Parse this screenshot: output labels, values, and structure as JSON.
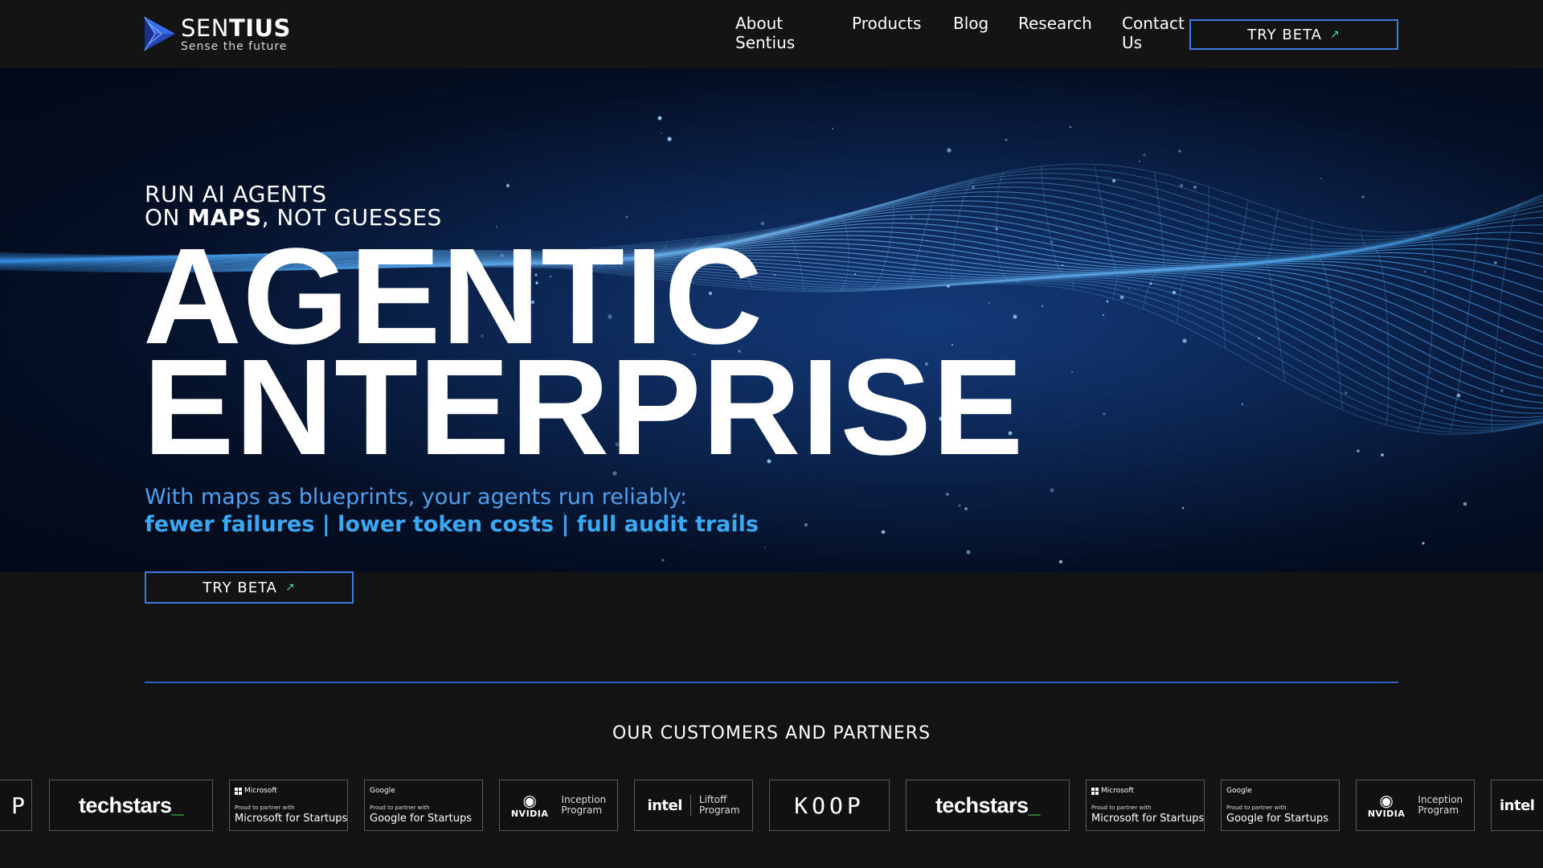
{
  "brand": {
    "name_light": "SEN",
    "name_bold": "TIUS",
    "tagline": "Sense the future"
  },
  "nav": {
    "about_line1": "About",
    "about_line2": "Sentius",
    "products": "Products",
    "blog": "Blog",
    "research": "Research",
    "contact_line1": "Contact",
    "contact_line2": "Us",
    "cta": "TRY BETA"
  },
  "hero": {
    "kicker_line1": "RUN AI AGENTS",
    "kicker_line2_pre": "ON ",
    "kicker_line2_bold": "MAPS",
    "kicker_line2_post": ", NOT GUESSES",
    "title_line1": "AGENTIC",
    "title_line2": "ENTERPRISE",
    "subtitle": "With maps as blueprints, your agents run reliably:",
    "highlights": "fewer failures | lower token costs | full audit trails",
    "cta": "TRY BETA"
  },
  "partners": {
    "title": "OUR CUSTOMERS AND PARTNERS",
    "techstars_word": "techstars",
    "techstars_underscore": "_",
    "microsoft_brand": "Microsoft",
    "microsoft_proud": "Proud to partner with",
    "microsoft_main": "Microsoft for Startups",
    "google_brand": "Google",
    "google_proud": "Proud to partner with",
    "google_main": "Google for Startups",
    "nvidia_word": "NVIDIA",
    "nvidia_prog_line1": "Inception",
    "nvidia_prog_line2": "Program",
    "intel_word": "intel",
    "intel_prog_line1": "Liftoff",
    "intel_prog_line2": "Program",
    "koop": "KOOP"
  },
  "colors": {
    "accent_blue": "#3f7be0",
    "arrow_teal": "#3ee0b8",
    "subtitle_blue": "#4ea0f0",
    "background": "#131313"
  },
  "icons": {
    "logo": "sentius-triangle-logo",
    "cta_arrow": "arrow-up-right-icon"
  }
}
